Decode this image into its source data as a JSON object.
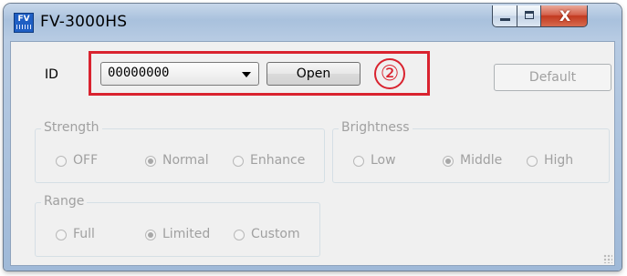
{
  "window": {
    "title": "FV-3000HS",
    "icon_text": "FV",
    "close_glyph": "X"
  },
  "id_row": {
    "label": "ID",
    "combo_value": "00000000",
    "open_label": "Open",
    "default_label": "Default",
    "callout_number": "②",
    "callout_color": "#d9232f"
  },
  "strength": {
    "legend": "Strength",
    "options": [
      "OFF",
      "Normal",
      "Enhance"
    ],
    "selected": "Normal"
  },
  "brightness": {
    "legend": "Brightness",
    "options": [
      "Low",
      "Middle",
      "High"
    ],
    "selected": "Middle"
  },
  "range": {
    "legend": "Range",
    "options": [
      "Full",
      "Limited",
      "Custom"
    ],
    "selected": "Limited"
  }
}
